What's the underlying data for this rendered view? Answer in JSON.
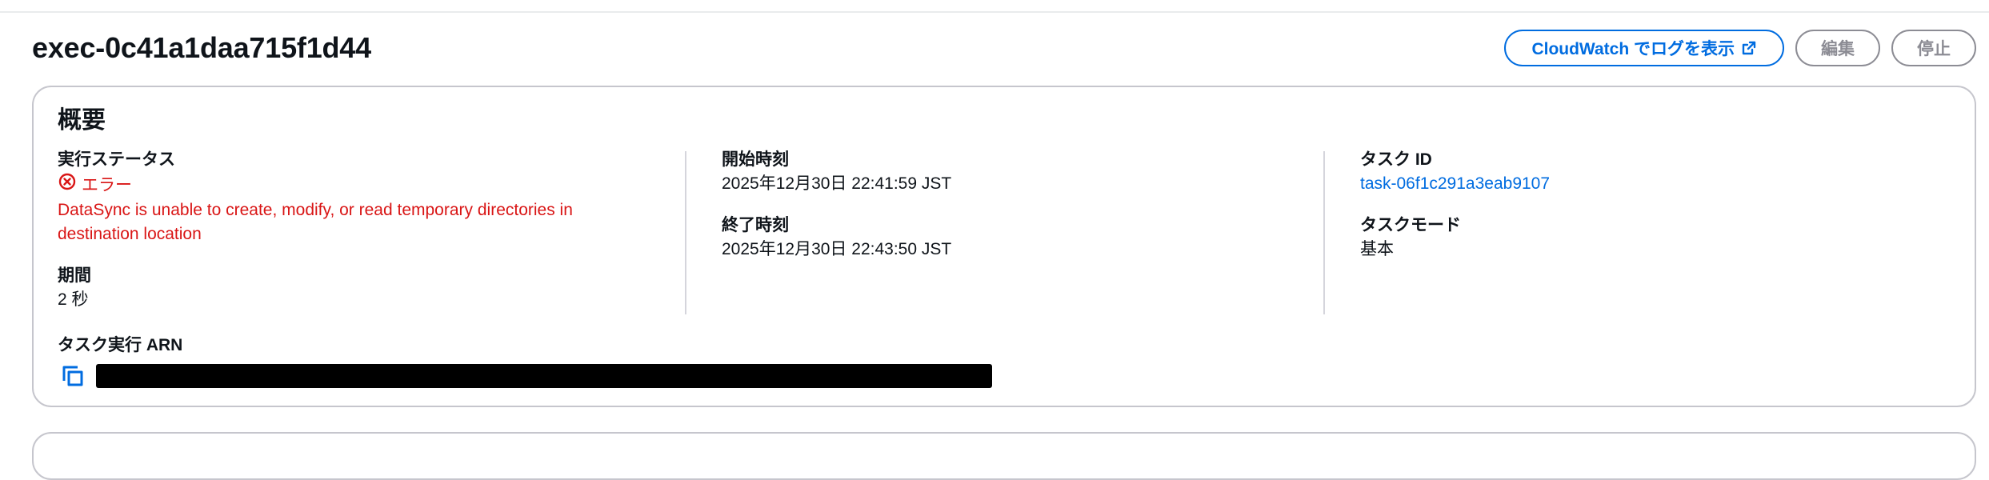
{
  "header": {
    "title": "exec-0c41a1daa715f1d44",
    "actions": {
      "cloudwatch_label": "CloudWatch でログを表示",
      "edit_label": "編集",
      "stop_label": "停止"
    }
  },
  "summary": {
    "title": "概要",
    "execution_status": {
      "label": "実行ステータス",
      "value": "エラー",
      "message": "DataSync is unable to create, modify, or read temporary directories in destination location"
    },
    "duration": {
      "label": "期間",
      "value": "2 秒"
    },
    "start_time": {
      "label": "開始時刻",
      "value": "2025年12月30日 22:41:59 JST"
    },
    "end_time": {
      "label": "終了時刻",
      "value": "2025年12月30日 22:43:50 JST"
    },
    "task_id": {
      "label": "タスク ID",
      "value": "task-06f1c291a3eab9107"
    },
    "task_mode": {
      "label": "タスクモード",
      "value": "基本"
    },
    "task_execution_arn": {
      "label": "タスク実行 ARN"
    }
  },
  "colors": {
    "link": "#006ce0",
    "error": "#d91515",
    "border": "#c6c6cd",
    "disabled": "#8c8c94"
  },
  "icons": {
    "external_link": "external-link-icon",
    "error_status": "error-circle-icon",
    "copy": "copy-icon"
  }
}
